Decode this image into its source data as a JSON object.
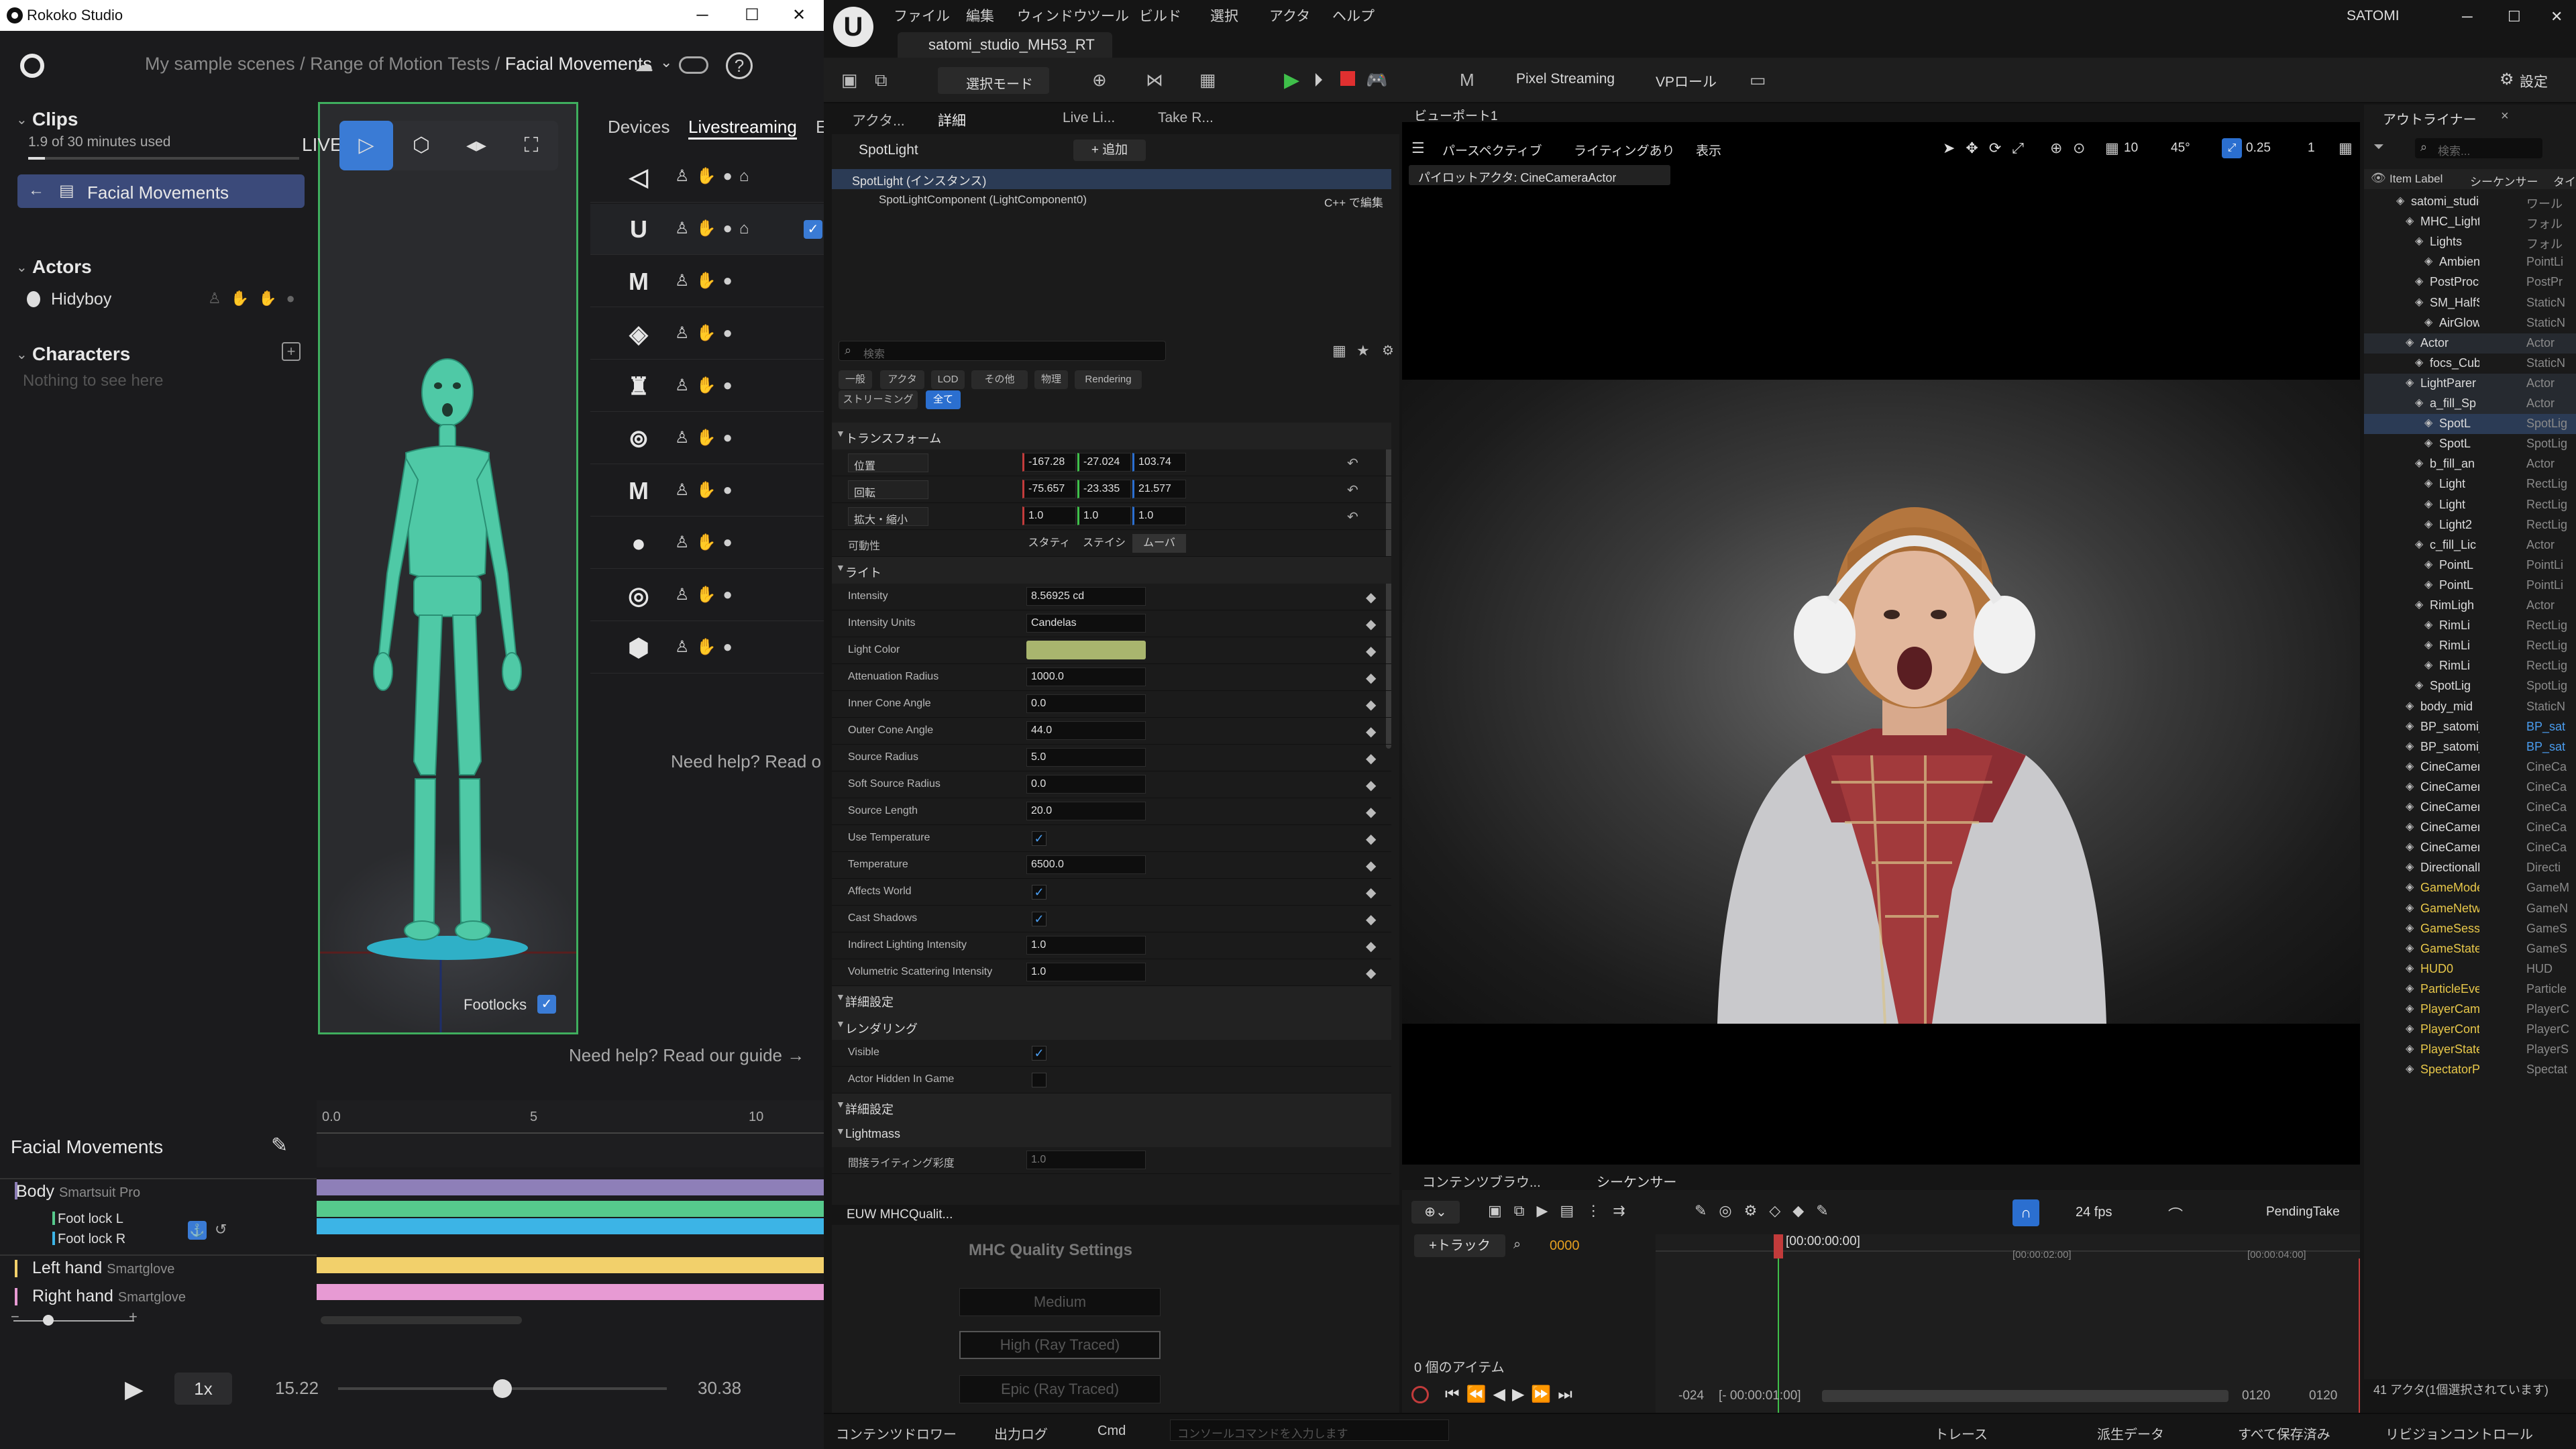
{
  "rokoko": {
    "window_title": "Rokoko Studio",
    "breadcrumb": {
      "part1": "My sample scenes",
      "sep": " / ",
      "part2": "Range of Motion Tests",
      "current": "Facial Movements"
    },
    "clips": {
      "title": "Clips",
      "usage": "1.9 of 30 minutes used",
      "usage_fraction": 0.063,
      "active_clip": "Facial Movements"
    },
    "actors": {
      "title": "Actors",
      "items": [
        {
          "name": "Hidyboy"
        }
      ]
    },
    "characters": {
      "title": "Characters",
      "empty": "Nothing to see here"
    },
    "viewport": {
      "live_label": "LIVE",
      "footlocks_label": "Footlocks"
    },
    "tabs": {
      "devices": "Devices",
      "livestreaming": "Livestreaming",
      "partial": "E"
    },
    "devices": [
      {
        "icon": "unity-icon",
        "glyph": "◁"
      },
      {
        "icon": "unreal-icon",
        "glyph": "U",
        "checked": true
      },
      {
        "icon": "motionbuilder-icon",
        "glyph": "M"
      },
      {
        "icon": "isaac-icon",
        "glyph": "◈"
      },
      {
        "icon": "houdini-icon",
        "glyph": "♜"
      },
      {
        "icon": "blender-icon",
        "glyph": "⊚"
      },
      {
        "icon": "maya-icon",
        "glyph": "M"
      },
      {
        "icon": "siemens-icon",
        "glyph": "●"
      },
      {
        "icon": "c4d-icon",
        "glyph": "◎"
      },
      {
        "icon": "custom-icon",
        "glyph": "⬢"
      }
    ],
    "need_help_right": "Need help? Read o",
    "need_help": "Need help? Read our guide →",
    "timeline": {
      "title": "Facial Movements",
      "ruler": [
        "0.0",
        "5",
        "10"
      ],
      "tracks": [
        {
          "name": "Body",
          "device": "Smartsuit Pro"
        },
        {
          "name": "Foot lock L",
          "device": ""
        },
        {
          "name": "Foot lock R",
          "device": ""
        },
        {
          "name": "Left hand",
          "device": "Smartglove"
        },
        {
          "name": "Right hand",
          "device": "Smartglove"
        }
      ],
      "speed": "1x",
      "time_current": "15.22",
      "time_total": "30.38",
      "playhead_fraction": 0.5
    },
    "colors": {
      "body": "#8e7fb8",
      "foot_l": "#56c98c",
      "foot_r": "#3cb4e6",
      "left_hand": "#f2d06b",
      "right_hand": "#e79ad3",
      "accent": "#3a7bd5",
      "live_border": "#3fae5e"
    }
  },
  "unreal": {
    "menu": [
      "ファイル",
      "編集",
      "ウィンドウ",
      "ツール",
      "ビルド",
      "選択",
      "アクタ",
      "ヘルプ"
    ],
    "project_tab": "satomi_studio_MH53_RT",
    "user": "SATOMI",
    "toolbar": {
      "select_mode": "選択モード",
      "pixel_streaming": "Pixel Streaming",
      "vp_role": "VPロール",
      "settings": "設定"
    },
    "panel_tabs": [
      "アクタ...",
      "詳細",
      "Live Li...",
      "Take R..."
    ],
    "details": {
      "actor_name": "SpotLight",
      "add_label": "+ 追加",
      "instance": "SpotLight (インスタンス)",
      "component": "SpotLightComponent (LightComponent0)",
      "edit_cpp": "C++ で編集",
      "search_placeholder": "検索",
      "filters": [
        "一般",
        "アクタ",
        "LOD",
        "その他",
        "物理",
        "Rendering",
        "ストリーミング",
        "全て"
      ],
      "transform_title": "トランスフォーム",
      "location": {
        "label": "位置",
        "x": "-167.28",
        "y": "-27.024",
        "z": "103.74"
      },
      "rotation": {
        "label": "回転",
        "x": "-75.657",
        "y": "-23.335",
        "z": "21.577"
      },
      "scale": {
        "label": "拡大・縮小",
        "x": "1.0",
        "y": "1.0",
        "z": "1.0"
      },
      "mobility": {
        "label": "可動性",
        "options": [
          "スタティ",
          "ステイシ",
          "ムーバ"
        ]
      },
      "light_title": "ライト",
      "light_props": [
        {
          "label": "Intensity",
          "value": "8.56925 cd"
        },
        {
          "label": "Intensity Units",
          "value": "Candelas"
        },
        {
          "label": "Light Color",
          "value": ""
        },
        {
          "label": "Attenuation Radius",
          "value": "1000.0"
        },
        {
          "label": "Inner Cone Angle",
          "value": "0.0"
        },
        {
          "label": "Outer Cone Angle",
          "value": "44.0"
        },
        {
          "label": "Source Radius",
          "value": "5.0"
        },
        {
          "label": "Soft Source Radius",
          "value": "0.0"
        },
        {
          "label": "Source Length",
          "value": "20.0"
        },
        {
          "label": "Use Temperature",
          "value": ""
        },
        {
          "label": "Temperature",
          "value": "6500.0"
        },
        {
          "label": "Affects World",
          "value": ""
        },
        {
          "label": "Cast Shadows",
          "value": ""
        },
        {
          "label": "Indirect Lighting Intensity",
          "value": "1.0"
        },
        {
          "label": "Volumetric Scattering Intensity",
          "value": "1.0"
        }
      ],
      "advanced": "詳細設定",
      "rendering_title": "レンダリング",
      "visible": "Visible",
      "hidden_in_game": "Actor Hidden In Game",
      "lightmass": "Lightmass",
      "indirect_sat": "間接ライティング彩度",
      "indirect_sat_val": "1.0",
      "light_color_hex": "#a9b56e"
    },
    "viewport": {
      "tab": "ビューポート1",
      "perspective": "パースペクティブ",
      "lighting": "ライティングあり",
      "show": "表示",
      "pilot": "パイロットアクタ: CineCameraActor",
      "grid": "10",
      "angle": "45°",
      "scale": "0.25",
      "cam": "1"
    },
    "outliner": {
      "title": "アウトライナー",
      "search_placeholder": "検索...",
      "col_label": "Item Label",
      "col_seq": "シーケンサー",
      "col_type": "タイプ",
      "items": [
        {
          "name": "satomi_studio",
          "type": "ワール"
        },
        {
          "name": "MHC_Lighti",
          "type": "フォル"
        },
        {
          "name": "Lights",
          "type": "フォル"
        },
        {
          "name": "Ambient",
          "type": "PointLi"
        },
        {
          "name": "PostProce",
          "type": "PostPr"
        },
        {
          "name": "SM_HalfS",
          "type": "StaticN"
        },
        {
          "name": "AirGlow",
          "type": "StaticN"
        },
        {
          "name": "Actor",
          "type": "Actor"
        },
        {
          "name": "focs_Cube",
          "type": "StaticN"
        },
        {
          "name": "LightParer",
          "type": "Actor"
        },
        {
          "name": "a_fill_Sp",
          "type": "Actor"
        },
        {
          "name": "SpotL",
          "type": "SpotLig"
        },
        {
          "name": "SpotL",
          "type": "SpotLig"
        },
        {
          "name": "b_fill_an",
          "type": "Actor"
        },
        {
          "name": "Light",
          "type": "RectLig"
        },
        {
          "name": "Light",
          "type": "RectLig"
        },
        {
          "name": "Light2",
          "type": "RectLig"
        },
        {
          "name": "c_fill_Lic",
          "type": "Actor"
        },
        {
          "name": "PointL",
          "type": "PointLi"
        },
        {
          "name": "PointL",
          "type": "PointLi"
        },
        {
          "name": "RimLigh",
          "type": "Actor"
        },
        {
          "name": "RimLi",
          "type": "RectLig"
        },
        {
          "name": "RimLi",
          "type": "RectLig"
        },
        {
          "name": "RimLi",
          "type": "RectLig"
        },
        {
          "name": "SpotLig",
          "type": "SpotLig"
        },
        {
          "name": "body_mid",
          "type": "StaticN"
        },
        {
          "name": "BP_satomi_",
          "type": "BP_sat"
        },
        {
          "name": "BP_satomi_",
          "type": "BP_sat"
        },
        {
          "name": "CineCamera",
          "type": "CineCa"
        },
        {
          "name": "CineCamera",
          "type": "CineCa"
        },
        {
          "name": "CineCamera",
          "type": "CineCa"
        },
        {
          "name": "CineCamera",
          "type": "CineCa"
        },
        {
          "name": "CineCamera",
          "type": "CineCa"
        },
        {
          "name": "DirectionalL",
          "type": "Directi"
        },
        {
          "name": "GameModeE",
          "type": "GameM"
        },
        {
          "name": "GameNetwo",
          "type": "GameN"
        },
        {
          "name": "GameSessic",
          "type": "GameS"
        },
        {
          "name": "GameStateE",
          "type": "GameS"
        },
        {
          "name": "HUD0",
          "type": "HUD"
        },
        {
          "name": "ParticleEver",
          "type": "Particle"
        },
        {
          "name": "PlayerCame",
          "type": "PlayerC"
        },
        {
          "name": "PlayerContr",
          "type": "PlayerC"
        },
        {
          "name": "PlayerStateI",
          "type": "PlayerS"
        },
        {
          "name": "SpectatorPa",
          "type": "Spectat"
        }
      ],
      "footer": "41 アクタ(1個選択されています)"
    },
    "mhc": {
      "tab": "EUW MHCQualit...",
      "title": "MHC Quality Settings",
      "medium": "Medium",
      "high": "High (Ray Traced)",
      "epic": "Epic (Ray Traced)"
    },
    "sequencer": {
      "tab_content": "コンテンツブラウ...",
      "tab_seq": "シーケンサー",
      "add_track": "+トラック",
      "frame": "0000",
      "fps": "24 fps",
      "take": "PendingTake",
      "items_count": "0 個のアイテム",
      "timecode": "[00:00:00:00]",
      "tc2": "[00:00:02:00]",
      "tc4": "[00:00:04:00]",
      "start": "-024",
      "start_tc": "[- 00:00:01:00]",
      "end1": "0120",
      "end2": "0120"
    },
    "status": {
      "content_drawer": "コンテンツドロワー",
      "output_log": "出力ログ",
      "cmd": "Cmd",
      "console_placeholder": "コンソールコマンドを入力します",
      "trace": "トレース",
      "derived": "派生データ",
      "save_all": "すべて保存済み",
      "revision": "リビジョンコントロール"
    }
  }
}
